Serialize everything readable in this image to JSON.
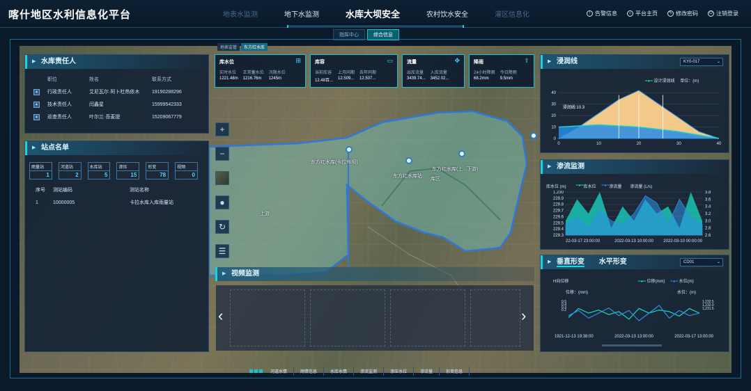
{
  "app_title": "喀什地区水利信息化平台",
  "nav": [
    {
      "label": "地表水监测",
      "dim": true
    },
    {
      "label": "地下水监测",
      "dim": false
    },
    {
      "label": "水库大坝安全",
      "dim": false,
      "active": true
    },
    {
      "label": "农村饮水安全",
      "dim": false
    },
    {
      "label": "灌区信息化",
      "dim": true
    }
  ],
  "actions": [
    {
      "icon": "bell-icon",
      "label": "告警信息"
    },
    {
      "icon": "home-icon",
      "label": "平台主页"
    },
    {
      "icon": "key-icon",
      "label": "修改密码"
    },
    {
      "icon": "power-icon",
      "label": "注销登录"
    }
  ],
  "subtabs": [
    "指挥中心",
    "综合信息"
  ],
  "map_tabs": [
    "地表监管",
    "东方红水库"
  ],
  "responsible": {
    "title": "水库责任人",
    "headers": [
      "职位",
      "姓名",
      "联系方式"
    ],
    "rows": [
      {
        "position": "行政责任人",
        "name": "艾尼瓦尔·阿卜杜热依木",
        "phone": "19190288296"
      },
      {
        "position": "技术责任人",
        "name": "闫鑫星",
        "phone": "15999542333"
      },
      {
        "position": "巡查责任人",
        "name": "叶尔兰·吾麦提",
        "phone": "15209067779"
      }
    ]
  },
  "stations": {
    "title": "站点名单",
    "counters": [
      {
        "label": "雨量站",
        "value": "1"
      },
      {
        "label": "河道站",
        "value": "2"
      },
      {
        "label": "水库站",
        "value": "5"
      },
      {
        "label": "渗压",
        "value": "15"
      },
      {
        "label": "形变",
        "value": "78"
      },
      {
        "label": "视频",
        "value": "0"
      }
    ],
    "headers": [
      "序号",
      "测站编码",
      "测站名称"
    ],
    "rows": [
      {
        "no": "1",
        "code": "10000005",
        "name": "卡拉水库入库雨量站"
      }
    ]
  },
  "kpis": [
    {
      "title": "库水位",
      "icon": "gauge-icon",
      "cells": [
        {
          "label": "实时水位",
          "value": "1221.48m"
        },
        {
          "label": "正常蓄水位",
          "value": "1216.76m"
        },
        {
          "label": "汛限水位",
          "value": "1245m"
        }
      ]
    },
    {
      "title": "库容",
      "icon": "box-icon",
      "cells": [
        {
          "label": "当前库容",
          "value": "12.48百..."
        },
        {
          "label": "上月同期",
          "value": "12.509..."
        },
        {
          "label": "去年同期",
          "value": "12.507..."
        }
      ]
    },
    {
      "title": "流量",
      "icon": "flow-icon",
      "cells": [
        {
          "label": "出库流量",
          "value": "3439.74..."
        },
        {
          "label": "入库流量",
          "value": "3452.02..."
        }
      ]
    },
    {
      "title": "降雨",
      "icon": "rain-icon",
      "cells": [
        {
          "label": "24小时降雨",
          "value": "68.2mm"
        },
        {
          "label": "今日降雨",
          "value": "9.5mm"
        }
      ]
    }
  ],
  "map_labels": [
    "东方红水库(卡拉布坝)",
    "东方红水库站",
    "东方红水库(上...下游)",
    "库区",
    "上游"
  ],
  "video": {
    "title": "视频监测"
  },
  "seepage_line": {
    "title": "浸润线",
    "select": "KY0-017",
    "legend": "设计浸润线",
    "unit": "单位：(m)",
    "note": "浸润线:10.3",
    "chart_data": {
      "type": "area",
      "x": [
        0,
        5,
        10,
        15,
        20,
        25,
        30,
        35,
        40
      ],
      "series": [
        {
          "name": "设计浸润线",
          "values": [
            10,
            11,
            12,
            11,
            10,
            8,
            6,
            3,
            0
          ]
        }
      ],
      "dam_profile": [
        0,
        10,
        22,
        34,
        42,
        30,
        18,
        6,
        0
      ],
      "xlim": [
        0,
        40
      ],
      "ylim": [
        0,
        45
      ],
      "xticks": [
        "0",
        "10",
        "20",
        "30",
        "40"
      ],
      "yticks": [
        "0",
        "10",
        "20",
        "30",
        "40"
      ]
    }
  },
  "seepage_flow": {
    "title": "渗流监测",
    "legend_axis_left": "库水位 (m)",
    "legend_items": [
      "库水位",
      "渗流量"
    ],
    "legend_axis_right": "渗流量 (L/s)",
    "chart_data": {
      "type": "area",
      "x_labels": [
        "22-03-17 23:00:00",
        "2022-03-13 10:00:00",
        "2022-03-10 00:00:00"
      ],
      "y_left_ticks": [
        "1,230",
        "229.9",
        "229.8",
        "229.7",
        "229.6",
        "229.5",
        "229.4",
        "229.3"
      ],
      "y_right_ticks": [
        "3.8",
        "3.6",
        "3.4",
        "3.2",
        "3.0",
        "2.8",
        "2.6"
      ],
      "series": [
        {
          "name": "库水位",
          "values": [
            229.5,
            229.8,
            229.6,
            229.9,
            229.4,
            229.7,
            229.5,
            229.8,
            229.6,
            229.7,
            229.4,
            229.9,
            229.5
          ]
        },
        {
          "name": "渗流量",
          "values": [
            2.9,
            3.1,
            2.8,
            3.3,
            3.0,
            2.9,
            3.2,
            3.7,
            3.5,
            2.9,
            3.6,
            3.1,
            2.9
          ]
        }
      ]
    }
  },
  "deformation": {
    "tabs": [
      "垂直形变",
      "水平形变"
    ],
    "select": "CD01",
    "subtitle": "H向位移",
    "legend_items": [
      "位移(mm)",
      "水位(m)"
    ],
    "axis_left": "位移：(mm)",
    "axis_right": "水位：(m)",
    "chart_data": {
      "type": "line",
      "x_labels": [
        "1921-12-13 19:38:00",
        "2022-03-13 13:00:00",
        "2022-03-17 13:00:00"
      ],
      "y_left_ticks": [
        "0.5",
        "0.4",
        "0.3",
        "0.2"
      ],
      "y_right_ticks": [
        "1,232.5",
        "1,232.0",
        "1,231.5"
      ],
      "series": [
        {
          "name": "位移(mm)",
          "values": [
            0.32,
            0.38,
            0.35,
            0.37,
            0.34,
            0.36,
            0.31,
            0.38,
            0.35,
            0.37,
            0.36,
            0.33,
            0.38,
            0.35
          ]
        },
        {
          "name": "水位(m)",
          "values": [
            1231.9,
            1232.1,
            1231.8,
            1232.0,
            1232.2,
            1231.9,
            1232.1,
            1231.7,
            1232.0,
            1232.3,
            1231.8,
            1232.1,
            1231.9,
            1232.0
          ]
        }
      ]
    }
  },
  "bottom_tabs": [
    "河道水情",
    "雨情信息",
    "水库水情",
    "渗流监测",
    "渗压水位",
    "渗流量",
    "形变信息"
  ]
}
